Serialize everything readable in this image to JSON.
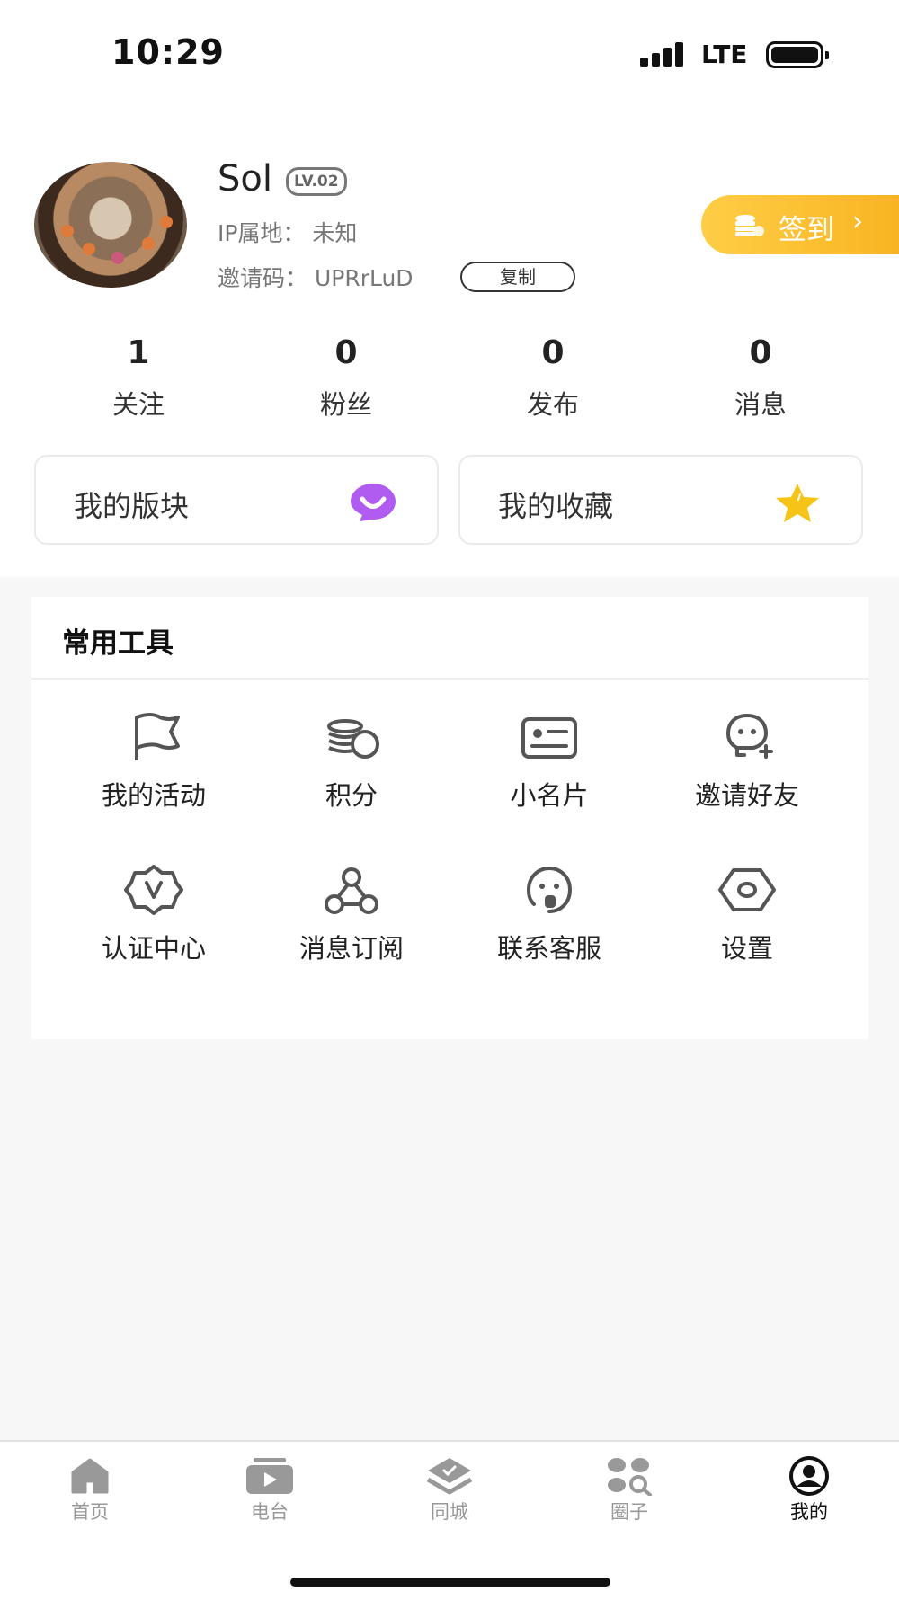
{
  "status_bar": {
    "time": "10:29",
    "network": "LTE"
  },
  "profile": {
    "name": "Sol",
    "level": "LV.02",
    "ip_location": "IP属地：  未知",
    "invite_code": "邀请码：  UPRrLuD",
    "copy_label": "复制",
    "signin_label": "签到"
  },
  "stats": [
    {
      "value": "1",
      "label": "关注"
    },
    {
      "value": "0",
      "label": "粉丝"
    },
    {
      "value": "0",
      "label": "发布"
    },
    {
      "value": "0",
      "label": "消息"
    }
  ],
  "cards": [
    {
      "label": "我的版块",
      "icon": "smile-chat-icon"
    },
    {
      "label": "我的收藏",
      "icon": "star-icon"
    }
  ],
  "tools": {
    "title": "常用工具",
    "items": [
      {
        "label": "我的活动",
        "icon": "flag-icon"
      },
      {
        "label": "积分",
        "icon": "coins-icon"
      },
      {
        "label": "小名片",
        "icon": "id-card-icon"
      },
      {
        "label": "邀请好友",
        "icon": "add-user-icon"
      },
      {
        "label": "认证中心",
        "icon": "verify-badge-icon"
      },
      {
        "label": "消息订阅",
        "icon": "webhook-icon"
      },
      {
        "label": "联系客服",
        "icon": "customer-service-icon"
      },
      {
        "label": "设置",
        "icon": "settings-hex-icon"
      }
    ]
  },
  "tabbar": {
    "items": [
      {
        "label": "首页",
        "icon": "home-icon"
      },
      {
        "label": "电台",
        "icon": "radio-play-icon"
      },
      {
        "label": "同城",
        "icon": "city-icon"
      },
      {
        "label": "圈子",
        "icon": "circle-group-icon"
      },
      {
        "label": "我的",
        "icon": "profile-icon",
        "active": true
      }
    ]
  },
  "colors": {
    "accent": "#f8b320",
    "purple": "#b05cf0",
    "star": "#f6c417"
  }
}
